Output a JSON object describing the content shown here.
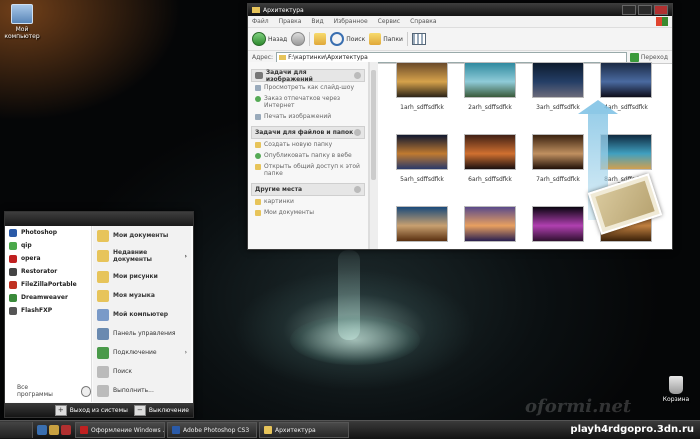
{
  "desktop": {
    "icons": [
      {
        "label_line1": "Мой",
        "label_line2": "компьютер"
      },
      {
        "label": "Корзина"
      }
    ],
    "site_text": "playh4rdgopro.3dn.ru",
    "watermark": "oformi.net"
  },
  "explorer": {
    "title": "Архитектура",
    "menu": [
      "Файл",
      "Правка",
      "Вид",
      "Избранное",
      "Сервис",
      "Справка"
    ],
    "toolbar": {
      "back": "Назад",
      "search": "Поиск",
      "folders": "Папки"
    },
    "address_label": "Адрес:",
    "address_value": "F:\\картинки\\Архитектура",
    "go_label": "Переход",
    "tasks": {
      "image_tasks_title": "Задачи для изображений",
      "image_tasks": [
        "Просмотреть как слайд-шоу",
        "Заказ отпечатков через Интернет",
        "Печать изображений"
      ],
      "file_tasks_title": "Задачи для файлов и папок",
      "file_tasks": [
        "Создать новую папку",
        "Опубликовать папку в вебе",
        "Открыть общий доступ к этой папке"
      ],
      "other_places_title": "Другие места",
      "other_places": [
        "картинки",
        "Мои документы"
      ]
    },
    "files": [
      {
        "caption": "1arh_sdffsdfkk",
        "colors": [
          "#6a4a2a",
          "#d6a24b",
          "#2c2418"
        ]
      },
      {
        "caption": "2arh_sdffsdfkk",
        "colors": [
          "#2f8aa0",
          "#8fcbd8",
          "#3a5a3a"
        ]
      },
      {
        "caption": "3arh_sdffsdfkk",
        "colors": [
          "#0d1b2e",
          "#243e66",
          "#6a6a7a"
        ]
      },
      {
        "caption": "4arh_sdffsdfkk",
        "colors": [
          "#1b2a44",
          "#4a6aa0",
          "#0d0d1a"
        ]
      },
      {
        "caption": "5arh_sdffsdfkk",
        "colors": [
          "#101830",
          "#c07a30",
          "#2a3a6a"
        ]
      },
      {
        "caption": "6arh_sdffsdfkk",
        "colors": [
          "#402015",
          "#d07030",
          "#1a1010"
        ]
      },
      {
        "caption": "7arh_sdffsdfkk",
        "colors": [
          "#3a2210",
          "#c09060",
          "#201008"
        ]
      },
      {
        "caption": "8arh_sdffsdfkk",
        "colors": [
          "#0f2a40",
          "#40a0c0",
          "#d0a050"
        ]
      },
      {
        "caption": "",
        "colors": [
          "#1a4a7a",
          "#c8a070",
          "#5a3010"
        ]
      },
      {
        "caption": "",
        "colors": [
          "#5a4a8a",
          "#e8a060",
          "#2a2050"
        ]
      },
      {
        "caption": "",
        "colors": [
          "#0a0510",
          "#b040b0",
          "#301030"
        ]
      },
      {
        "caption": "",
        "colors": [
          "#5a3010",
          "#c08040",
          "#3a2008"
        ]
      }
    ]
  },
  "startmenu": {
    "left_items": [
      {
        "label": "Photoshop",
        "color": "#2a5aa8"
      },
      {
        "label": "qip",
        "color": "#4aa84a"
      },
      {
        "label": "opera",
        "color": "#c02020"
      },
      {
        "label": "Restorator",
        "color": "#444444"
      },
      {
        "label": "FileZillaPortable",
        "color": "#c03020"
      },
      {
        "label": "Dreamweaver",
        "color": "#3a8a3a"
      },
      {
        "label": "FlashFXP",
        "color": "#555555"
      }
    ],
    "all_programs": "Все программы",
    "right_items": [
      {
        "label": "Мои документы",
        "color": "#e7c45a",
        "bold": true,
        "more": false
      },
      {
        "label": "Недавние документы",
        "color": "#e7c45a",
        "bold": true,
        "more": true
      },
      {
        "label": "Мои рисунки",
        "color": "#e7c45a",
        "bold": true,
        "more": false
      },
      {
        "label": "Моя музыка",
        "color": "#e7c45a",
        "bold": true,
        "more": false
      },
      {
        "label": "Мой компьютер",
        "color": "#7a9ac8",
        "bold": true,
        "more": false
      },
      {
        "label": "Панель управления",
        "color": "#6a8ab0",
        "bold": false,
        "more": false
      },
      {
        "label": "Подключение",
        "color": "#4a9a4a",
        "bold": false,
        "more": true
      },
      {
        "label": "Поиск",
        "color": "#bbbbbb",
        "bold": false,
        "more": false
      },
      {
        "label": "Выполнить...",
        "color": "#bbbbbb",
        "bold": false,
        "more": false
      }
    ],
    "logoff": "Выход из системы",
    "shutdown": "Выключение"
  },
  "taskbar": {
    "tasks": [
      {
        "label": "Оформление Windows ...",
        "color": "#c02020"
      },
      {
        "label": "Adobe Photoshop CS3",
        "color": "#2a5aa8"
      },
      {
        "label": "Архитектура",
        "color": "#e7c45a"
      }
    ]
  }
}
